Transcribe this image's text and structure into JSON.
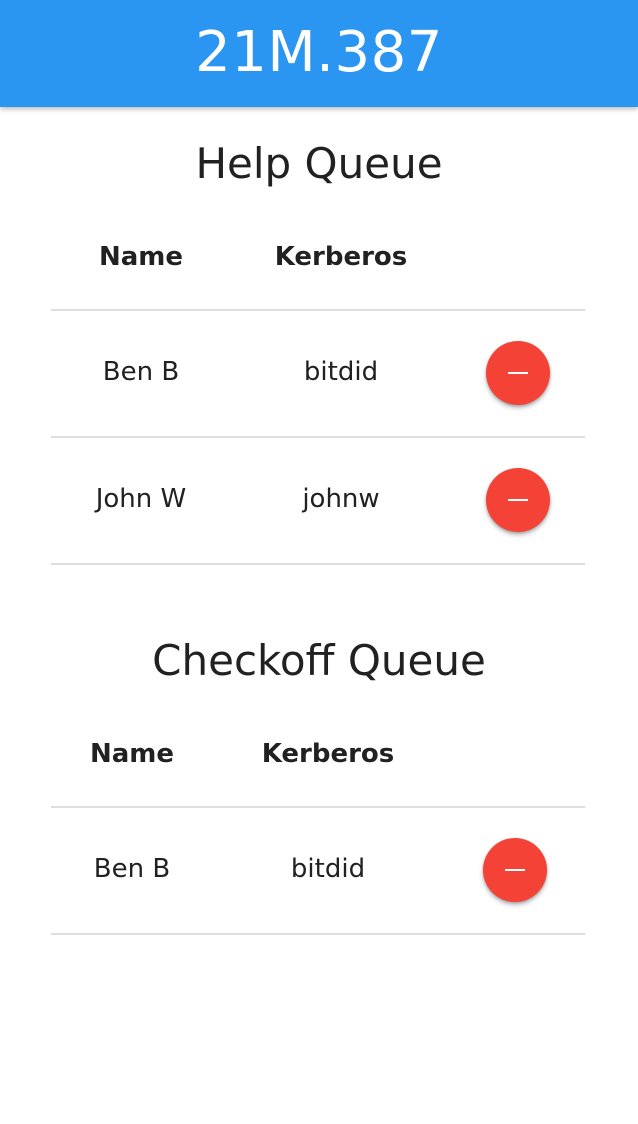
{
  "app_bar": {
    "title": "21M.387"
  },
  "help_queue": {
    "title": "Help Queue",
    "columns": [
      "Name",
      "Kerberos"
    ],
    "rows": [
      {
        "name": "Ben B",
        "kerberos": "bitdid",
        "action_icon": "minus-icon"
      },
      {
        "name": "John W",
        "kerberos": "johnw",
        "action_icon": "minus-icon"
      }
    ]
  },
  "checkoff_queue": {
    "title": "Checkoff Queue",
    "columns": [
      "Name",
      "Kerberos"
    ],
    "rows": [
      {
        "name": "Ben B",
        "kerberos": "bitdid",
        "action_icon": "minus-icon"
      }
    ]
  },
  "colors": {
    "app_bar": "#2b95f2",
    "remove_button": "#f44336",
    "divider": "#dedede",
    "text": "#212121"
  }
}
